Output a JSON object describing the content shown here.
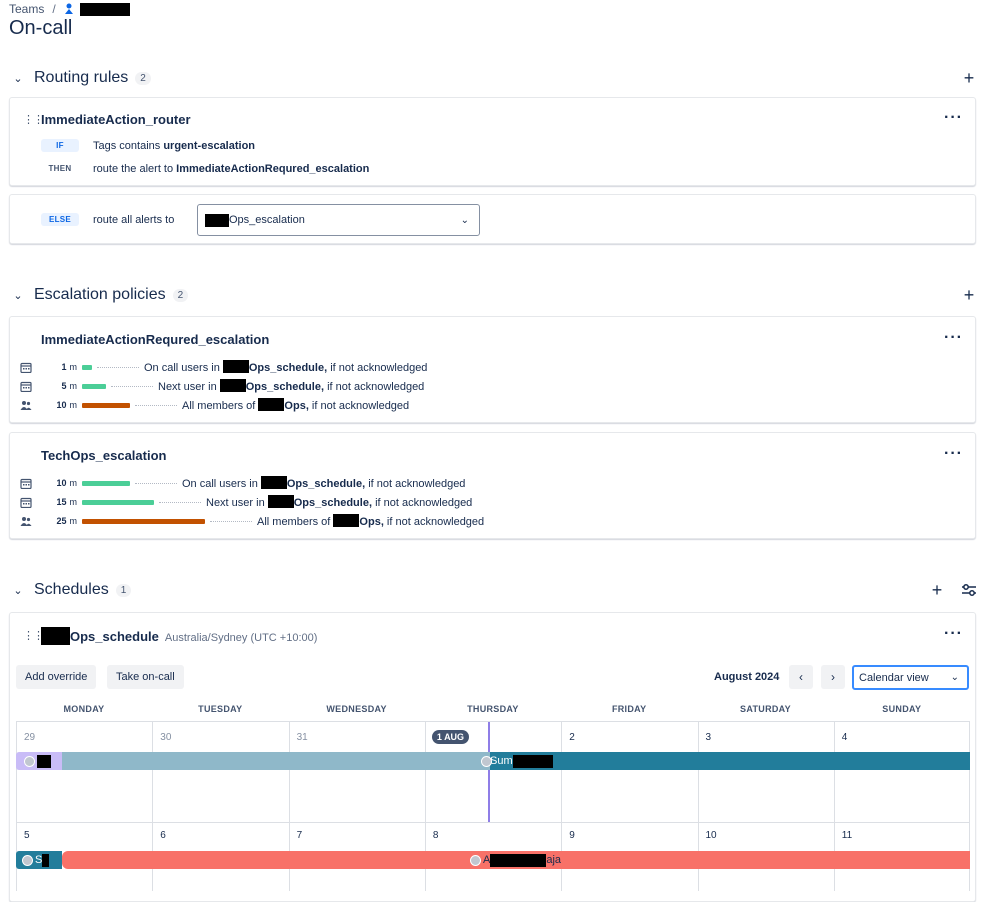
{
  "breadcrumb": {
    "root": "Teams",
    "separator": "/"
  },
  "page": {
    "title": "On-call"
  },
  "routing": {
    "title": "Routing rules",
    "count": "2",
    "rule": {
      "name": "ImmediateAction_router",
      "if_kw": "IF",
      "if_text": "Tags contains ",
      "if_value": "urgent-escalation",
      "then_kw": "THEN",
      "then_text": "route the alert to ",
      "then_value": "ImmediateActionRequred_escalation"
    },
    "else": {
      "kw": "ELSE",
      "text": "route all alerts to",
      "selected": "Ops_escalation"
    }
  },
  "escalation": {
    "title": "Escalation policies",
    "count": "2",
    "policies": [
      {
        "name": "ImmediateActionRequred_escalation",
        "rows": [
          {
            "icon": "calendar-icon",
            "mins": "1",
            "unit": "m",
            "pre": "On call users in ",
            "bold": "Ops_schedule,",
            "post": " if not acknowledged",
            "color": "#4bce97",
            "fill": 0.06
          },
          {
            "icon": "calendar-icon",
            "mins": "5",
            "unit": "m",
            "pre": "Next user in ",
            "bold": "Ops_schedule,",
            "post": " if not acknowledged",
            "color": "#4bce97",
            "fill": 0.15
          },
          {
            "icon": "people-icon",
            "mins": "10",
            "unit": "m",
            "pre": "All members of ",
            "bold": "Ops,",
            "post": " if not acknowledged",
            "color": "#c25100",
            "fill": 0.3
          }
        ]
      },
      {
        "name": "TechOps_escalation",
        "rows": [
          {
            "icon": "calendar-icon",
            "mins": "10",
            "unit": "m",
            "pre": "On call users in ",
            "bold": "Ops_schedule,",
            "post": " if not acknowledged",
            "color": "#4bce97",
            "fill": 0.3
          },
          {
            "icon": "calendar-icon",
            "mins": "15",
            "unit": "m",
            "pre": "Next user in ",
            "bold": "Ops_schedule,",
            "post": " if not acknowledged",
            "color": "#4bce97",
            "fill": 0.45
          },
          {
            "icon": "people-icon",
            "mins": "25",
            "unit": "m",
            "pre": "All members of ",
            "bold": "Ops,",
            "post": " if not acknowledged",
            "color": "#c25100",
            "fill": 0.77
          }
        ]
      }
    ]
  },
  "schedules": {
    "title": "Schedules",
    "count": "1",
    "schedule": {
      "name": "Ops_schedule",
      "timezone": "Australia/Sydney (UTC +10:00)",
      "add_override": "Add override",
      "take_oncall": "Take on-call",
      "month": "August 2024",
      "view": "Calendar view",
      "days_of_week": [
        "MONDAY",
        "TUESDAY",
        "WEDNESDAY",
        "THURSDAY",
        "FRIDAY",
        "SATURDAY",
        "SUNDAY"
      ],
      "week1": [
        "29",
        "30",
        "31",
        "1 AUG",
        "2",
        "3",
        "4"
      ],
      "week2": [
        "5",
        "6",
        "7",
        "8",
        "9",
        "10",
        "11"
      ],
      "shifts": {
        "w1_b": "Sum",
        "w2_a": "S",
        "w2_b_pre": "A",
        "w2_b_post": "aja"
      },
      "colors": {
        "lavender": "#c9bcf7",
        "steel": "#8fb8c9",
        "teal": "#227d9b",
        "coral": "#f87168",
        "now": "#8f7ee7"
      }
    }
  }
}
